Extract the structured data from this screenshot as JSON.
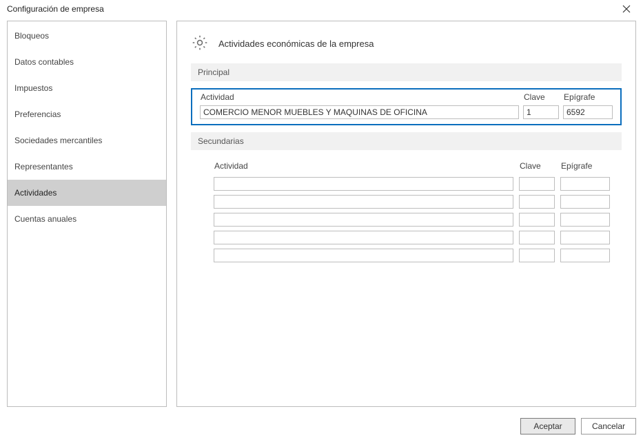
{
  "window": {
    "title": "Configuración de empresa"
  },
  "sidebar": {
    "items": [
      {
        "label": "Bloqueos"
      },
      {
        "label": "Datos contables"
      },
      {
        "label": "Impuestos"
      },
      {
        "label": "Preferencias"
      },
      {
        "label": "Sociedades mercantiles"
      },
      {
        "label": "Representantes"
      },
      {
        "label": "Actividades"
      },
      {
        "label": "Cuentas anuales"
      }
    ],
    "selected_index": 6
  },
  "content": {
    "heading": "Actividades económicas de la empresa",
    "principal": {
      "section_label": "Principal",
      "columns": {
        "actividad": "Actividad",
        "clave": "Clave",
        "epigrafe": "Epígrafe"
      },
      "row": {
        "actividad": "COMERCIO MENOR MUEBLES Y MAQUINAS DE OFICINA",
        "clave": "1",
        "epigrafe": "6592"
      }
    },
    "secundarias": {
      "section_label": "Secundarias",
      "columns": {
        "actividad": "Actividad",
        "clave": "Clave",
        "epigrafe": "Epígrafe"
      },
      "rows": [
        {
          "actividad": "",
          "clave": "",
          "epigrafe": ""
        },
        {
          "actividad": "",
          "clave": "",
          "epigrafe": ""
        },
        {
          "actividad": "",
          "clave": "",
          "epigrafe": ""
        },
        {
          "actividad": "",
          "clave": "",
          "epigrafe": ""
        },
        {
          "actividad": "",
          "clave": "",
          "epigrafe": ""
        }
      ]
    }
  },
  "footer": {
    "accept": "Aceptar",
    "cancel": "Cancelar"
  }
}
